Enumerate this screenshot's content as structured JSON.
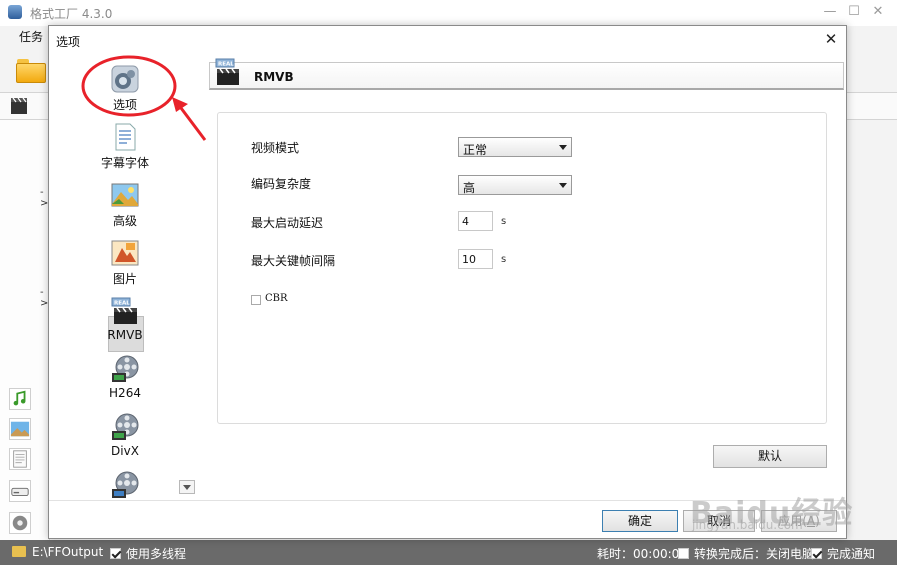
{
  "app": {
    "title": "格式工厂 4.3.0",
    "menu_task": "任务"
  },
  "dialog": {
    "title": "选项",
    "close_glyph": "✕"
  },
  "categories": [
    {
      "label": "选项",
      "icon": "gear-camera-icon"
    },
    {
      "label": "字幕字体",
      "icon": "document-icon"
    },
    {
      "label": "高级",
      "icon": "landscape-icon"
    },
    {
      "label": "图片",
      "icon": "picture-icon"
    },
    {
      "label": "RMVB",
      "icon": "real-clapperboard-icon"
    },
    {
      "label": "H264",
      "icon": "film-reel-icon"
    },
    {
      "label": "DivX",
      "icon": "film-reel-icon"
    },
    {
      "label": "",
      "icon": "film-reel-icon"
    }
  ],
  "selected_category": "RMVB",
  "section": {
    "title": "RMVB"
  },
  "settings": {
    "video_mode_label": "视频模式",
    "video_mode_value": "正常",
    "encode_complexity_label": "编码复杂度",
    "encode_complexity_value": "高",
    "max_start_delay_label": "最大启动延迟",
    "max_start_delay_value": "4",
    "max_start_delay_unit": "s",
    "max_keyframe_interval_label": "最大关键帧间隔",
    "max_keyframe_interval_value": "10",
    "max_keyframe_interval_unit": "s",
    "cbr_label": "CBR",
    "cbr_checked": false
  },
  "buttons": {
    "default": "默认",
    "ok": "确定",
    "cancel": "取消",
    "apply_prefix": "应用(",
    "apply_key": "A",
    "apply_suffix": ")"
  },
  "main_panel": {
    "arrow_1": "->",
    "arrow_2": "->"
  },
  "status_bar": {
    "output_path": "E:\\FFOutput",
    "multithread_label": "使用多线程",
    "multithread_checked": true,
    "elapsed": "耗时：00:00:00",
    "after_convert": "转换完成后：关闭电脑",
    "after_convert_checked": false,
    "notify_label": "完成通知",
    "notify_checked": true
  },
  "watermark": {
    "text": "Baidu经验",
    "sub": "jingyan.baidu.com"
  },
  "colors": {
    "annotation": "#e8222a",
    "status_bar_bg": "#6a6a6a",
    "ok_border": "#3c7fb1"
  }
}
